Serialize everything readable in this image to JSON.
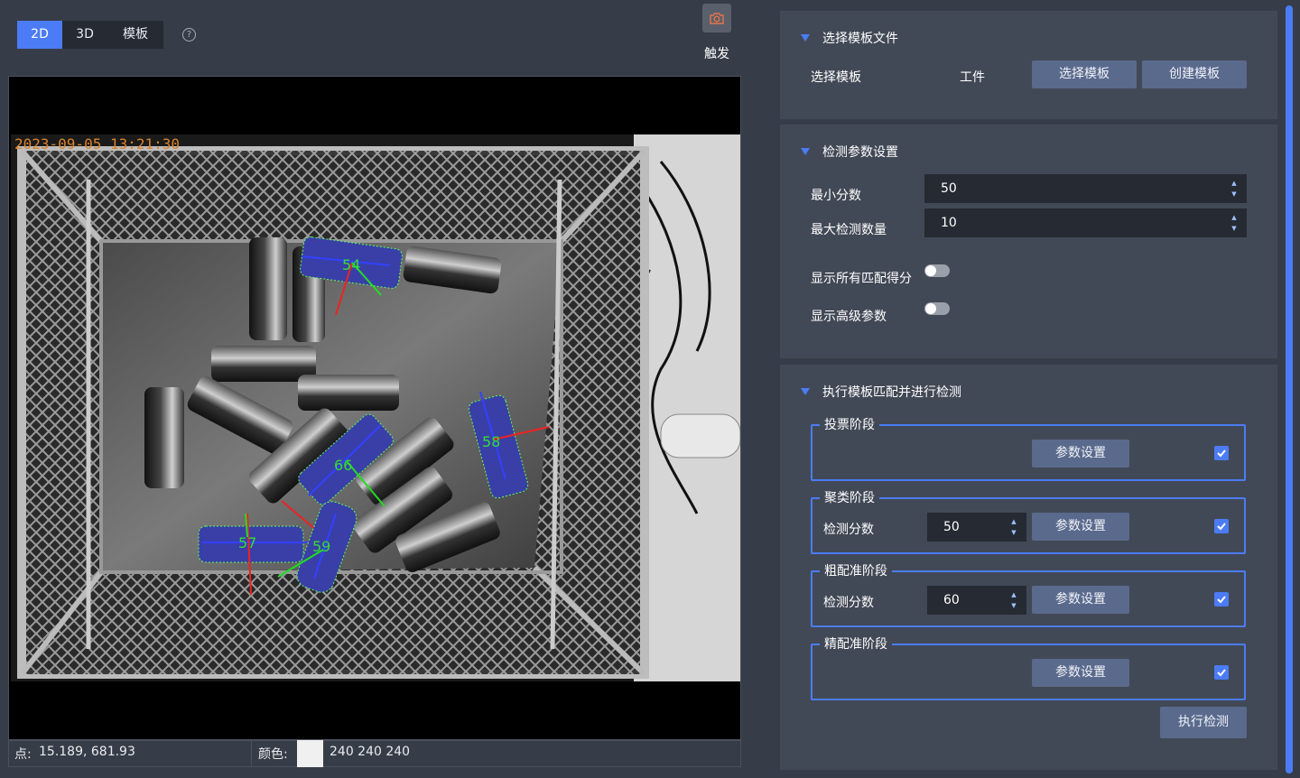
{
  "tabs": [
    {
      "label": "2D",
      "active": true
    },
    {
      "label": "3D",
      "active": false
    },
    {
      "label": "模板",
      "active": false
    }
  ],
  "help_icon": "question-circle-icon",
  "trigger": {
    "label": "触发",
    "icon": "camera-icon"
  },
  "viewer": {
    "timestamp": "2023-09-05 13:21:30",
    "detections": [
      {
        "score": "54"
      },
      {
        "score": "58"
      },
      {
        "score": "66"
      },
      {
        "score": "57"
      },
      {
        "score": "59"
      }
    ]
  },
  "status": {
    "point_label": "点:",
    "point_value": "15.189, 681.93",
    "color_label": "颜色:",
    "color_value": "240 240 240"
  },
  "template_section": {
    "title": "选择模板文件",
    "label": "选择模板",
    "value": "工件",
    "select_button": "选择模板",
    "create_button": "创建模板"
  },
  "params_section": {
    "title": "检测参数设置",
    "min_score_label": "最小分数",
    "min_score_value": "50",
    "max_count_label": "最大检测数量",
    "max_count_value": "10",
    "show_all_label": "显示所有匹配得分",
    "show_all_on": false,
    "show_adv_label": "显示高级参数",
    "show_adv_on": false
  },
  "execute_section": {
    "title": "执行模板匹配并进行检测",
    "stages": [
      {
        "title": "投票阶段",
        "param_button": "参数设置",
        "checked": true
      },
      {
        "title": "聚类阶段",
        "score_label": "检测分数",
        "score_value": "50",
        "param_button": "参数设置",
        "checked": true
      },
      {
        "title": "粗配准阶段",
        "score_label": "检测分数",
        "score_value": "60",
        "param_button": "参数设置",
        "checked": true
      },
      {
        "title": "精配准阶段",
        "param_button": "参数设置",
        "checked": true
      }
    ],
    "run_button": "执行检测"
  },
  "colors": {
    "accent": "#4b7cf5",
    "background": "#373d48",
    "panel": "#424956",
    "button": "#5a6a8d",
    "input": "#252a33",
    "timestamp": "#d9822b",
    "detection_fill": "#3a3fa8",
    "detection_label": "#33dd33"
  }
}
